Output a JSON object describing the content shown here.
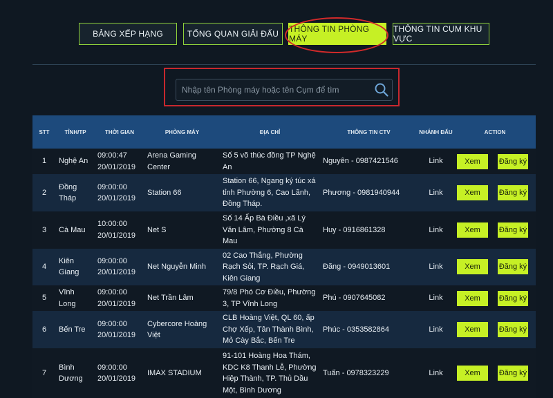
{
  "tabs": [
    {
      "label": "BẢNG XẾP HẠNG"
    },
    {
      "label": "TỔNG QUAN GIẢI ĐẤU"
    },
    {
      "label": "THÔNG TIN PHÒNG MÁY"
    },
    {
      "label": "THÔNG TIN CỤM KHU VỰC"
    }
  ],
  "active_tab": "THÔNG TIN PHÒNG MÁY",
  "search": {
    "placeholder": "Nhập tên Phòng máy hoặc tên Cụm để tìm",
    "value": ""
  },
  "table": {
    "headers": [
      "STT",
      "TỈNH/TP",
      "THỜI GIAN",
      "PHÒNG MÁY",
      "ĐỊA CHỈ",
      "THÔNG TIN CTV",
      "NHÁNH ĐẤU",
      "ACTION"
    ],
    "rows": [
      {
        "stt": "1",
        "tinh": "Nghệ An",
        "time": "09:00:47",
        "date": "20/01/2019",
        "phong_may": "Arena Gaming Center",
        "dia_chi": "Số 5 võ thúc đồng TP Nghệ An",
        "ctv": "Nguyên - 0987421546",
        "nhanh_dau": "Link",
        "xem": "Xem",
        "dang_ky": "Đăng ký"
      },
      {
        "stt": "2",
        "tinh": "Đồng Tháp",
        "time": "09:00:00",
        "date": "20/01/2019",
        "phong_may": "Station 66",
        "dia_chi": "Station 66, Ngang ký túc xá tỉnh Phường 6, Cao Lãnh, Đồng Tháp.",
        "ctv": "Phương - 0981940944",
        "nhanh_dau": "Link",
        "xem": "Xem",
        "dang_ky": "Đăng ký"
      },
      {
        "stt": "3",
        "tinh": "Cà Mau",
        "time": "10:00:00",
        "date": "20/01/2019",
        "phong_may": "Net S",
        "dia_chi": "Số 14 Ấp Bà Điều ,xã Lý Văn Lâm, Phường 8 Cà Mau",
        "ctv": "Huy - 0916861328",
        "nhanh_dau": "Link",
        "xem": "Xem",
        "dang_ky": "Đăng ký"
      },
      {
        "stt": "4",
        "tinh": "Kiên Giang",
        "time": "09:00:00",
        "date": "20/01/2019",
        "phong_may": "Net Nguyễn Minh",
        "dia_chi": "02 Cao Thắng, Phường Rạch Sỏi, TP. Rạch Giá, Kiên Giang",
        "ctv": "Đăng - 0949013601",
        "nhanh_dau": "Link",
        "xem": "Xem",
        "dang_ky": "Đăng ký"
      },
      {
        "stt": "5",
        "tinh": "Vĩnh Long",
        "time": "09:00:00",
        "date": "20/01/2019",
        "phong_may": "Net Trần Lâm",
        "dia_chi": "79/8 Phó Cơ Điều, Phường 3, TP Vĩnh Long",
        "ctv": "Phú - 0907645082",
        "nhanh_dau": "Link",
        "xem": "Xem",
        "dang_ky": "Đăng ký"
      },
      {
        "stt": "6",
        "tinh": "Bến Tre",
        "time": "09:00:00",
        "date": "20/01/2019",
        "phong_may": "Cybercore Hoàng Việt",
        "dia_chi": "CLB Hoàng Việt, QL 60, ấp Chợ Xếp, Tân Thành Bình, Mỏ Cày Bắc, Bến Tre",
        "ctv": "Phúc - 0353582864",
        "nhanh_dau": "Link",
        "xem": "Xem",
        "dang_ky": "Đăng ký"
      },
      {
        "stt": "7",
        "tinh": "Bình Dương",
        "time": "09:00:00",
        "date": "20/01/2019",
        "phong_may": "IMAX STADIUM",
        "dia_chi": "91-101 Hoàng Hoa Thám, KDC K8 Thanh Lễ, Phường Hiệp Thành, TP. Thủ Dầu Một, Bình Dương",
        "ctv": "Tuấn - 0978323229",
        "nhanh_dau": "Link",
        "xem": "Xem",
        "dang_ky": "Đăng ký"
      }
    ]
  },
  "colors": {
    "background": "#0f1822",
    "accent": "#c6f025",
    "header_blue": "#1d4a7c",
    "highlight_red": "#d22a2a"
  },
  "icons": {
    "search": "search-icon"
  }
}
